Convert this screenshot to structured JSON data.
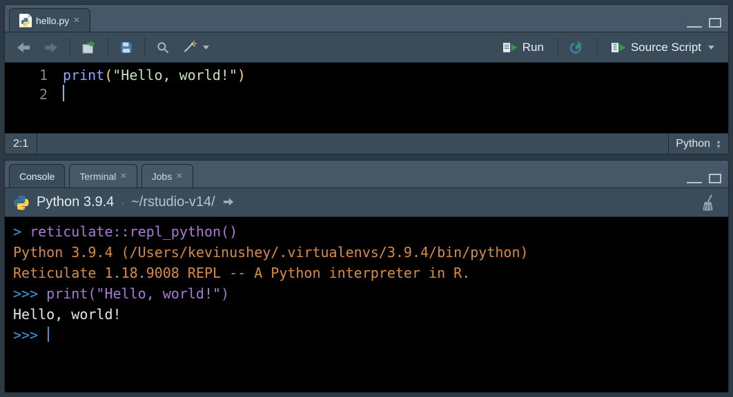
{
  "editor": {
    "tab": {
      "filename": "hello.py"
    },
    "toolbar": {
      "run_label": "Run",
      "source_label": "Source Script"
    },
    "lines": [
      {
        "n": "1",
        "code_html": "<span class='tok-fn'>print</span><span class='tok-paren'>(</span><span class='tok-str'>\"Hello, world!\"</span><span class='tok-paren'>)</span>"
      },
      {
        "n": "2",
        "code_html": ""
      }
    ],
    "status": {
      "pos": "2:1",
      "language": "Python"
    }
  },
  "bottom": {
    "tabs": {
      "console": "Console",
      "terminal": "Terminal",
      "jobs": "Jobs"
    },
    "header": {
      "title": "Python 3.9.4",
      "path": "~/rstudio-v14/"
    },
    "console_lines": [
      {
        "cls": "",
        "html": "<span class='c-blue'>&gt; </span><span class='c-purple'>reticulate::repl_python()</span>"
      },
      {
        "cls": "c-orange",
        "html": "Python 3.9.4 (/Users/kevinushey/.virtualenvs/3.9.4/bin/python)"
      },
      {
        "cls": "c-orange",
        "html": "Reticulate 1.18.9008 REPL -- A Python interpreter in R."
      },
      {
        "cls": "",
        "html": "<span class='c-blue'>&gt;&gt;&gt; </span><span class='c-purple'>print(\"Hello, world!\")</span>"
      },
      {
        "cls": "c-white",
        "html": "Hello, world!"
      },
      {
        "cls": "",
        "html": "<span class='c-blue'>&gt;&gt;&gt; </span><span class='cursor'></span>"
      }
    ]
  }
}
